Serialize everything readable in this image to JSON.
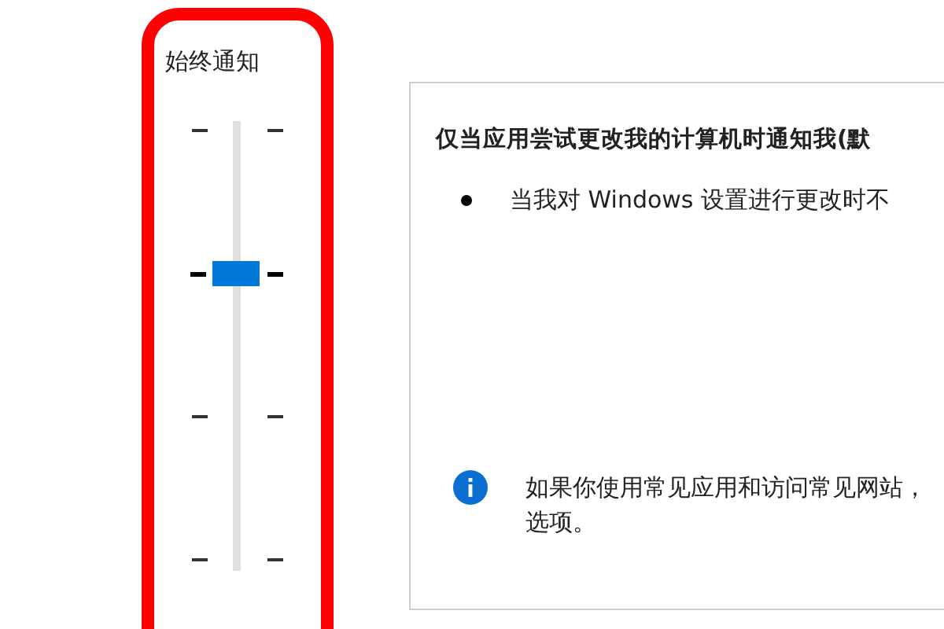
{
  "slider": {
    "top_label": "始终通知",
    "level": 0.667
  },
  "panel": {
    "title": "仅当应用尝试更改我的计算机时通知我(默",
    "bullets": [
      "当我对 Windows 设置进行更改时不"
    ],
    "info_lines": [
      "如果你使用常见应用和访问常见网站，",
      "选项。"
    ]
  }
}
